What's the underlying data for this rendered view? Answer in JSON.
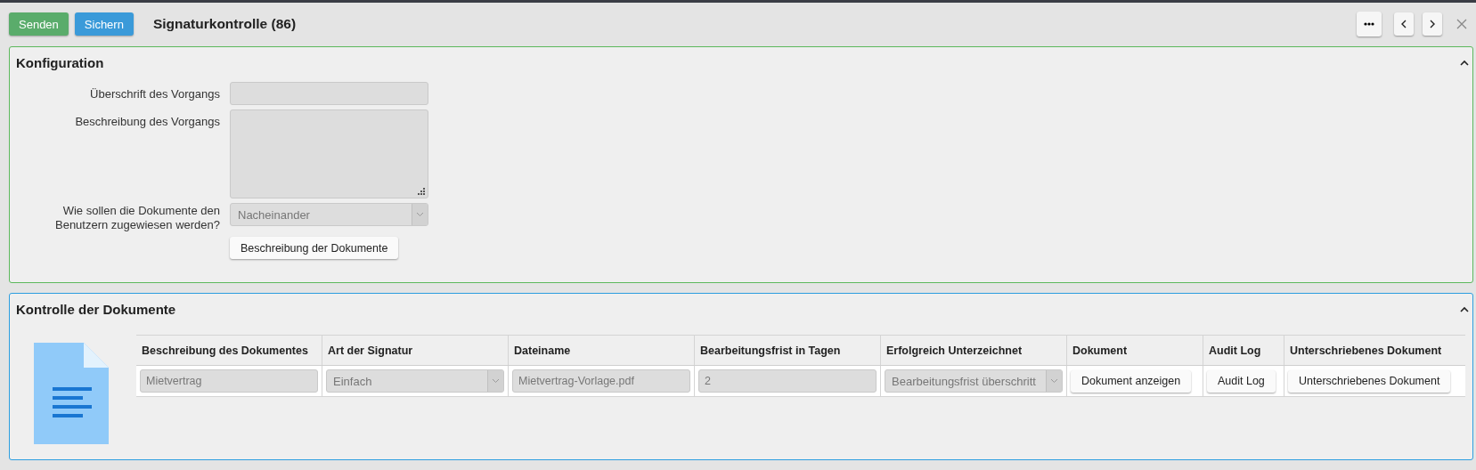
{
  "toolbar": {
    "buttons": [
      {
        "label": "Senden",
        "kind": "success"
      },
      {
        "label": "Sichern",
        "kind": "primary"
      }
    ],
    "title": "Signaturkontrolle (86)"
  },
  "panels": [
    {
      "title": "Konfiguration",
      "kind": "config",
      "expanded": true,
      "fields": [
        {
          "label": "Überschrift des Vorgangs",
          "kind": "input",
          "disabled": true
        },
        {
          "label": "Beschreibung des Vorgangs",
          "kind": "textarea",
          "disabled": true
        },
        {
          "label": "Wie sollen die Dokumente den Benutzern zugewiesen werden?",
          "kind": "select",
          "value": "Nacheinander",
          "disabled": true
        }
      ],
      "action": "Beschreibung der Dokumente"
    },
    {
      "title": "Kontrolle der Dokumente",
      "kind": "table",
      "expanded": true,
      "table": {
        "columns": [
          "Beschreibung des Dokumentes",
          "Art der Signatur",
          "Dateiname",
          "Bearbeitungsfrist in Tagen",
          "Erfolgreich Unterzeichnet",
          "Dokument",
          "Audit Log",
          "Unterschriebenes Dokument"
        ],
        "rows": [
          [
            {
              "kind": "input",
              "value": "Mietvertrag",
              "disabled": true
            },
            {
              "kind": "select",
              "value": "Einfach",
              "disabled": true
            },
            {
              "kind": "input",
              "value": "Mietvertrag-Vorlage.pdf",
              "disabled": true
            },
            {
              "kind": "input",
              "value": "2",
              "disabled": true
            },
            {
              "kind": "select",
              "value": "Bearbeitungsfrist überschritt",
              "disabled": true
            },
            {
              "kind": "button",
              "value": "Dokument anzeigen"
            },
            {
              "kind": "button",
              "value": "Audit Log"
            },
            {
              "kind": "button",
              "value": "Unterschriebenes Dokument"
            }
          ]
        ]
      }
    }
  ]
}
